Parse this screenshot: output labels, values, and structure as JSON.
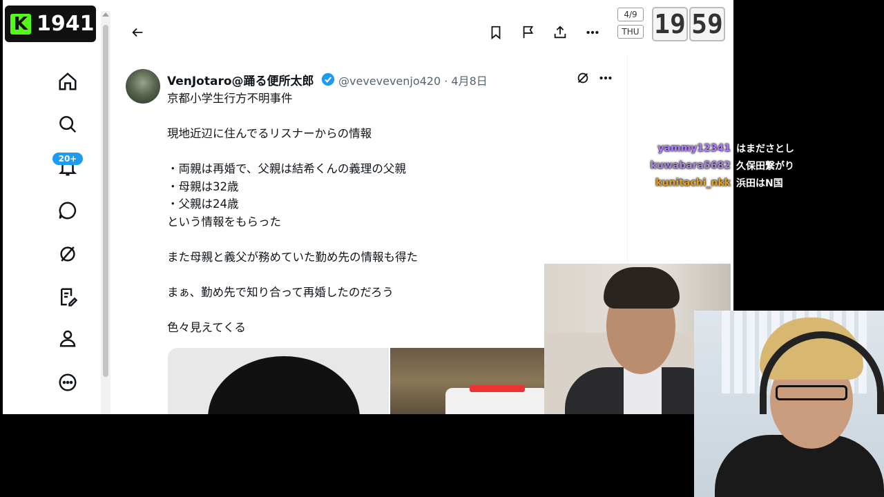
{
  "overlay": {
    "viewer_count": "1941",
    "kick_glyph": "K",
    "date": "4/9",
    "weekday": "THU",
    "clock_hour": "19",
    "clock_minute": "59"
  },
  "sidebar": {
    "icons": [
      "home-icon",
      "search-icon",
      "bell-icon",
      "messages-icon",
      "grok-icon",
      "notes-icon",
      "profile-icon",
      "more-icon"
    ],
    "notification_badge": "20+"
  },
  "topbar": {
    "icons": [
      "back-arrow-icon",
      "bookmark-icon",
      "flag-icon",
      "share-icon",
      "more-icon"
    ]
  },
  "tweet": {
    "author_name": "VenJotaro@踊る便所太郎",
    "author_meta": "@vevevevenjo420 · 4月8日",
    "lines": [
      "京都小学生行方不明事件",
      "",
      "現地近辺に住んでるリスナーからの情報",
      "",
      "・両親は再婚で、父親は結希くんの義理の父親",
      "・母親は32歳",
      "・父親は24歳",
      "という情報をもらった",
      "",
      "また母親と義父が務めていた勤め先の情報も得た",
      "",
      "まぁ、勤め先で知り合って再婚したのだろう",
      "",
      "色々見えてくる"
    ],
    "accent_color": "#1d9bf0"
  },
  "chat": [
    {
      "user": "yammy12341",
      "message": "はまださとし",
      "color": "#b07cff"
    },
    {
      "user": "kuwabara5682",
      "message": "久保田繋がり",
      "color": "#a58ad8"
    },
    {
      "user": "kunitachi_nkk",
      "message": "浜田はN国",
      "color": "#e0a020"
    }
  ]
}
